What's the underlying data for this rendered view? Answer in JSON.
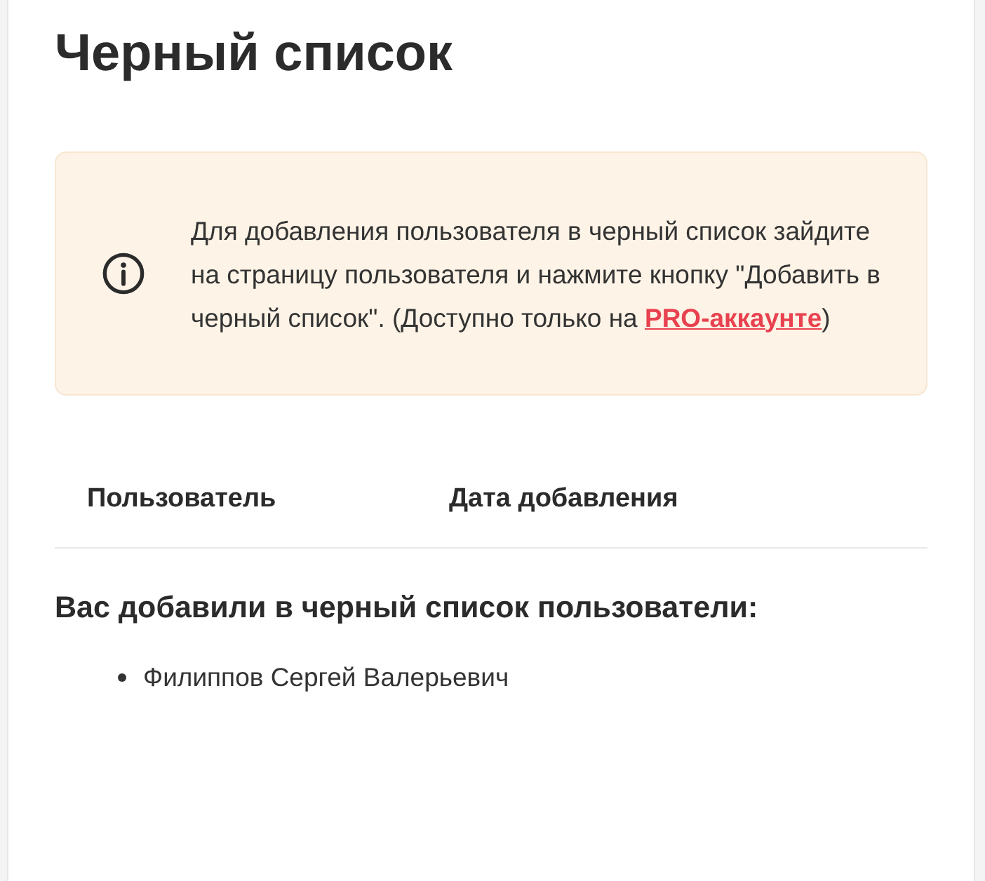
{
  "page": {
    "title": "Черный список"
  },
  "notice": {
    "text": "Для добавления пользователя в черный список зайдите на страницу пользователя и нажмите кнопку \"Добавить в черный список\". (Доступно только на ",
    "link": "PRO-аккаунте",
    "after": ")"
  },
  "table": {
    "columns": [
      "Пользователь",
      "Дата добавления"
    ]
  },
  "blocked_by": {
    "heading": "Вас добавили в черный список пользователи:",
    "users": [
      "Филиппов Сергей Валерьевич"
    ]
  }
}
